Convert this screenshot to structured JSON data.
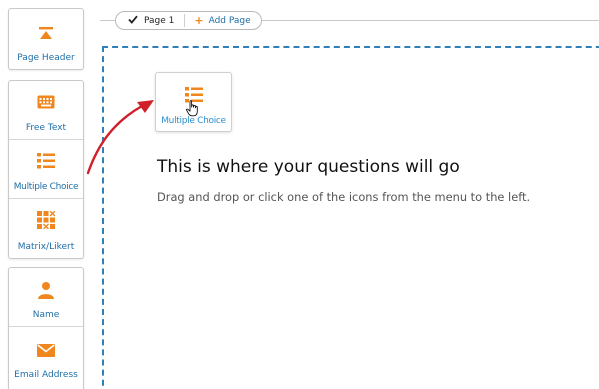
{
  "toolbox": {
    "groups": [
      {
        "items": [
          {
            "label": "Page Header",
            "icon": "page-header-icon"
          }
        ]
      },
      {
        "items": [
          {
            "label": "Free Text",
            "icon": "keyboard-icon"
          },
          {
            "label": "Multiple Choice",
            "icon": "multiple-choice-icon"
          },
          {
            "label": "Matrix/Likert",
            "icon": "matrix-likert-icon"
          }
        ]
      },
      {
        "items": [
          {
            "label": "Name",
            "icon": "person-icon"
          },
          {
            "label": "Email Address",
            "icon": "envelope-icon"
          }
        ]
      }
    ]
  },
  "tabs": {
    "page_label": "Page 1",
    "add_page_label": "Add Page"
  },
  "canvas": {
    "dragged_item_label": "Multiple Choice",
    "headline": "This is where your questions will go",
    "subline": "Drag and drop or click one of the icons from the menu to the left."
  },
  "colors": {
    "accent_orange": "#f0871e",
    "link_blue": "#1e6fa8",
    "dropzone_border": "#2f7fb8",
    "arrow_red": "#d0202a"
  }
}
